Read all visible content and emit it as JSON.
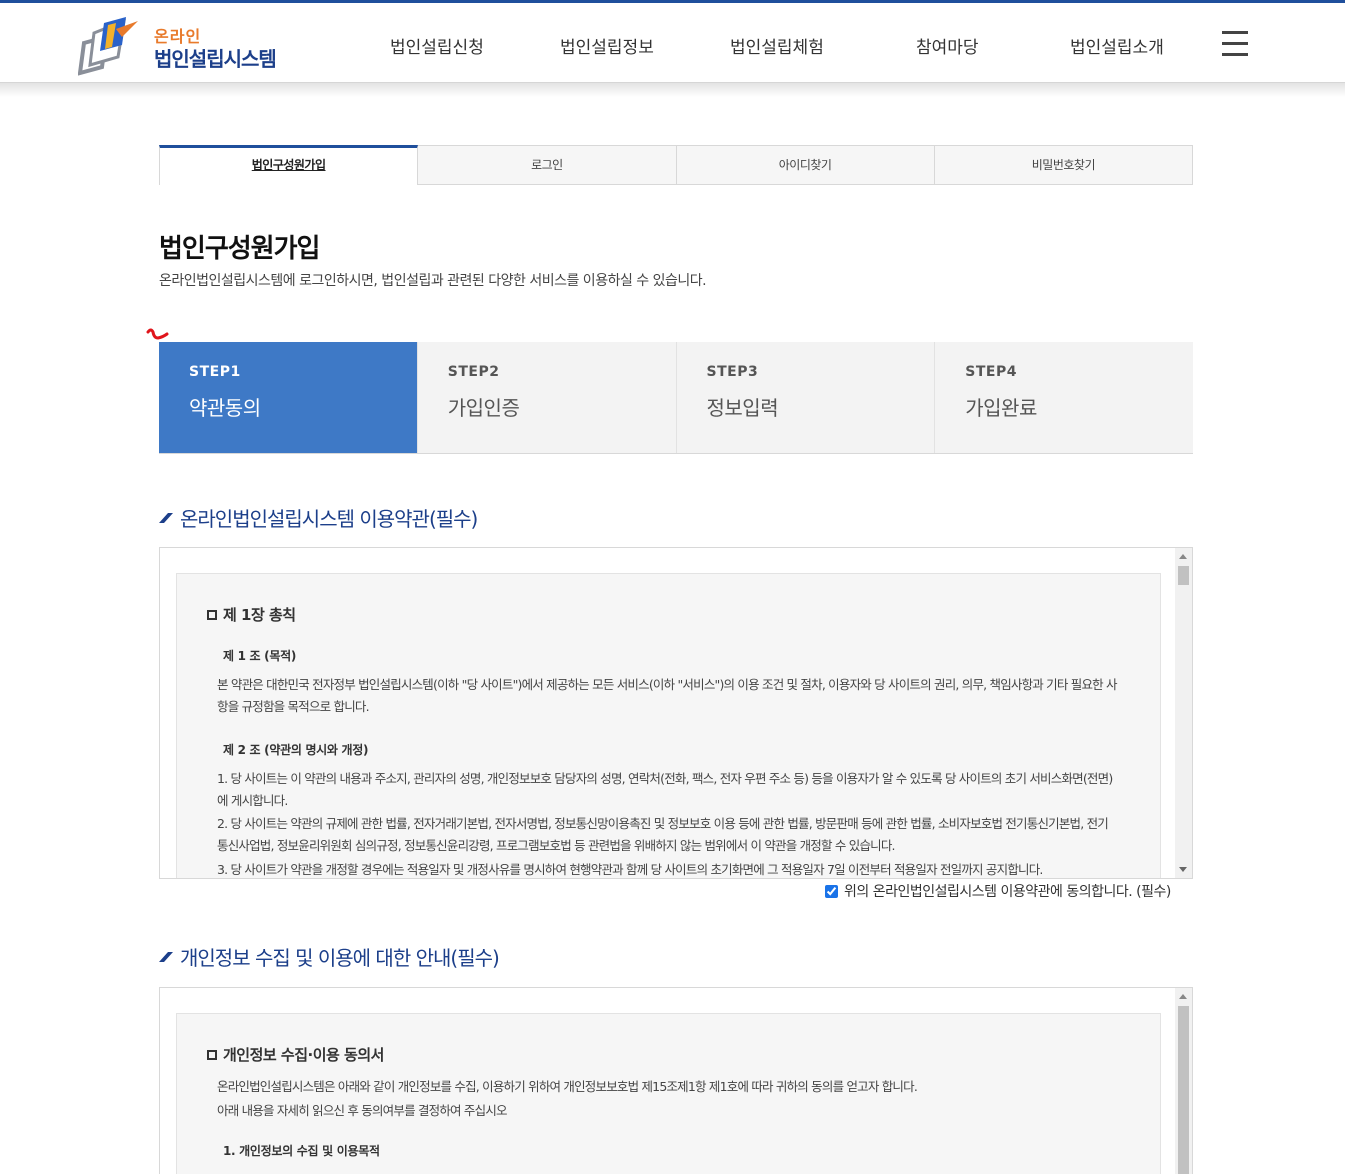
{
  "header": {
    "logo_small": "온라인",
    "logo_big": "법인설립시스템",
    "nav": [
      {
        "label": "법인설립신청"
      },
      {
        "label": "법인설립정보"
      },
      {
        "label": "법인설립체험"
      },
      {
        "label": "참여마당"
      },
      {
        "label": "법인설립소개"
      }
    ],
    "menu_icon": "hamburger-menu-icon"
  },
  "tabs": [
    {
      "label": "법인구성원가입",
      "active": true
    },
    {
      "label": "로그인",
      "active": false
    },
    {
      "label": "아이디찾기",
      "active": false
    },
    {
      "label": "비밀번호찾기",
      "active": false
    }
  ],
  "page": {
    "title": "법인구성원가입",
    "description": "온라인법인설립시스템에 로그인하시면, 법인설립과 관련된 다양한 서비스를 이용하실 수 있습니다."
  },
  "steps": [
    {
      "num": "STEP1",
      "label": "약관동의",
      "active": true
    },
    {
      "num": "STEP2",
      "label": "가입인증",
      "active": false
    },
    {
      "num": "STEP3",
      "label": "정보입력",
      "active": false
    },
    {
      "num": "STEP4",
      "label": "가입완료",
      "active": false
    }
  ],
  "terms": {
    "title": "온라인법인설립시스템 이용약관(필수)",
    "chapter": "제 1장 총칙",
    "article1_title": "제 1 조 (목적)",
    "article1_body": "본 약관은 대한민국 전자정부 법인설립시스템(이하 \"당 사이트\")에서 제공하는 모든 서비스(이하 \"서비스\")의 이용 조건 및 절차, 이용자와 당 사이트의 권리, 의무, 책임사항과 기타 필요한 사항을 규정함을 목적으로 합니다.",
    "article2_title": "제 2 조 (약관의 명시와 개정)",
    "article2_p1": "1. 당 사이트는 이 약관의 내용과 주소지, 관리자의 성명, 개인정보보호 담당자의 성명, 연락처(전화, 팩스, 전자 우편 주소 등) 등을 이용자가 알 수 있도록 당 사이트의 초기 서비스화면(전면)에 게시합니다.",
    "article2_p2": "2. 당 사이트는 약관의 규제에 관한 법률, 전자거래기본법, 전자서명법, 정보통신망이용촉진 및 정보보호 이용 등에 관한 법률, 방문판매 등에 관한 법률, 소비자보호법 전기통신기본법, 전기통신사업법, 정보윤리위원회 심의규정, 정보통신윤리강령, 프로그램보호법 등 관련법을 위배하지 않는 범위에서 이 약관을 개정할 수 있습니다.",
    "article2_p3": "3. 당 사이트가 약관을 개정할 경우에는 적용일자 및 개정사유를 명시하여 현행약관과 함께 당 사이트의 초기화면에 그 적용일자 7일 이전부터 적용일자 전일까지 공지합니다.",
    "agree_label": "위의 온라인법인설립시스템 이용약관에 동의합니다. (필수)",
    "agree_checked": true
  },
  "privacy": {
    "title": "개인정보 수집 및 이용에 대한 안내(필수)",
    "heading": "개인정보 수집·이용 동의서",
    "body1": "온라인법인설립시스템은 아래와 같이 개인정보를 수집, 이용하기 위하여 개인정보보호법 제15조제1항 제1호에 따라 귀하의 동의를 얻고자 합니다.",
    "body2": "아래 내용을 자세히 읽으신 후 동의여부를 결정하여 주십시오",
    "item1": "1. 개인정보의 수집 및 이용목적"
  },
  "colors": {
    "brand_blue": "#1f4f9c",
    "step_active": "#3e79c6",
    "logo_orange": "#e87a2b"
  }
}
